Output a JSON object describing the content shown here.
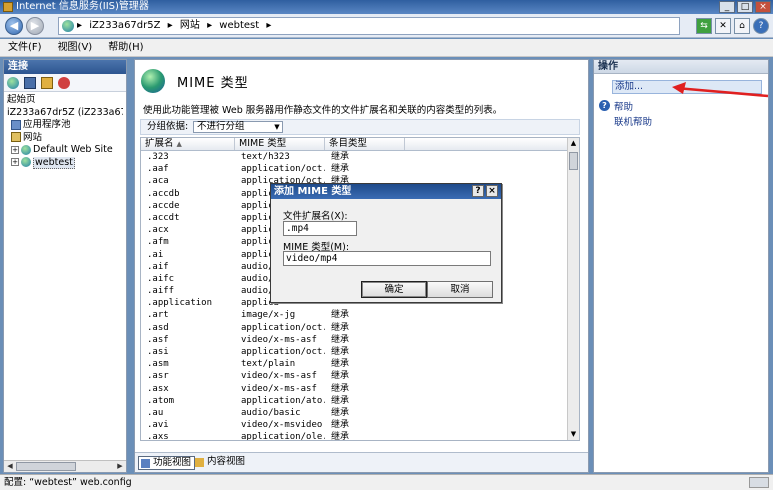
{
  "window": {
    "title": "Internet 信息服务(IIS)管理器",
    "min_label": "_",
    "max_label": "□",
    "close_label": "×"
  },
  "address": {
    "crumbs": [
      "iZ233a67dr5Z",
      "网站",
      "webtest"
    ],
    "separator": "▸"
  },
  "menu": [
    "文件(F)",
    "视图(V)",
    "帮助(H)"
  ],
  "left_panel": {
    "header": "连接",
    "tree": {
      "start": "起始页",
      "server": "iZ233a67dr5Z (iZ233a67dr5Z\\",
      "app_pools": "应用程序池",
      "sites": "网站",
      "site_default": "Default Web Site",
      "site_webtest": "webtest"
    }
  },
  "center": {
    "title": "MIME 类型",
    "description": "使用此功能管理被 Web 服务器用作静态文件的文件扩展名和关联的内容类型的列表。",
    "groupby_label": "分组依据:",
    "groupby_value": "不进行分组",
    "columns": [
      "扩展名",
      "MIME 类型",
      "条目类型"
    ],
    "rows": [
      [
        ".323",
        "text/h323",
        "继承"
      ],
      [
        ".aaf",
        "application/oct...",
        "继承"
      ],
      [
        ".aca",
        "application/oct...",
        "继承"
      ],
      [
        ".accdb",
        "applica",
        ""
      ],
      [
        ".accde",
        "applica",
        ""
      ],
      [
        ".accdt",
        "applica",
        ""
      ],
      [
        ".acx",
        "applica",
        ""
      ],
      [
        ".afm",
        "applica",
        ""
      ],
      [
        ".ai",
        "applica",
        ""
      ],
      [
        ".aif",
        "audio/x",
        ""
      ],
      [
        ".aifc",
        "audio/x",
        ""
      ],
      [
        ".aiff",
        "audio/x",
        ""
      ],
      [
        ".application",
        "applica",
        ""
      ],
      [
        ".art",
        "image/x-jg",
        "继承"
      ],
      [
        ".asd",
        "application/oct...",
        "继承"
      ],
      [
        ".asf",
        "video/x-ms-asf",
        "继承"
      ],
      [
        ".asi",
        "application/oct...",
        "继承"
      ],
      [
        ".asm",
        "text/plain",
        "继承"
      ],
      [
        ".asr",
        "video/x-ms-asf",
        "继承"
      ],
      [
        ".asx",
        "video/x-ms-asf",
        "继承"
      ],
      [
        ".atom",
        "application/ato...",
        "继承"
      ],
      [
        ".au",
        "audio/basic",
        "继承"
      ],
      [
        ".avi",
        "video/x-msvideo",
        "继承"
      ],
      [
        ".axs",
        "application/ole...",
        "继承"
      ]
    ],
    "tabs": {
      "features": "功能视图",
      "content": "内容视图"
    }
  },
  "right_panel": {
    "header": "操作",
    "add": "添加...",
    "help": "帮助",
    "online_help": "联机帮助"
  },
  "status": "配置: “webtest” web.config",
  "dialog": {
    "title": "添加 MIME 类型",
    "help_btn": "?",
    "close_btn": "×",
    "ext_label": "文件扩展名(X):",
    "ext_value": ".mp4",
    "mime_label": "MIME 类型(M):",
    "mime_value": "video/mp4",
    "ok": "确定",
    "cancel": "取消"
  },
  "colors": {
    "accent": "#2d5590",
    "arrow": "#e02020"
  }
}
